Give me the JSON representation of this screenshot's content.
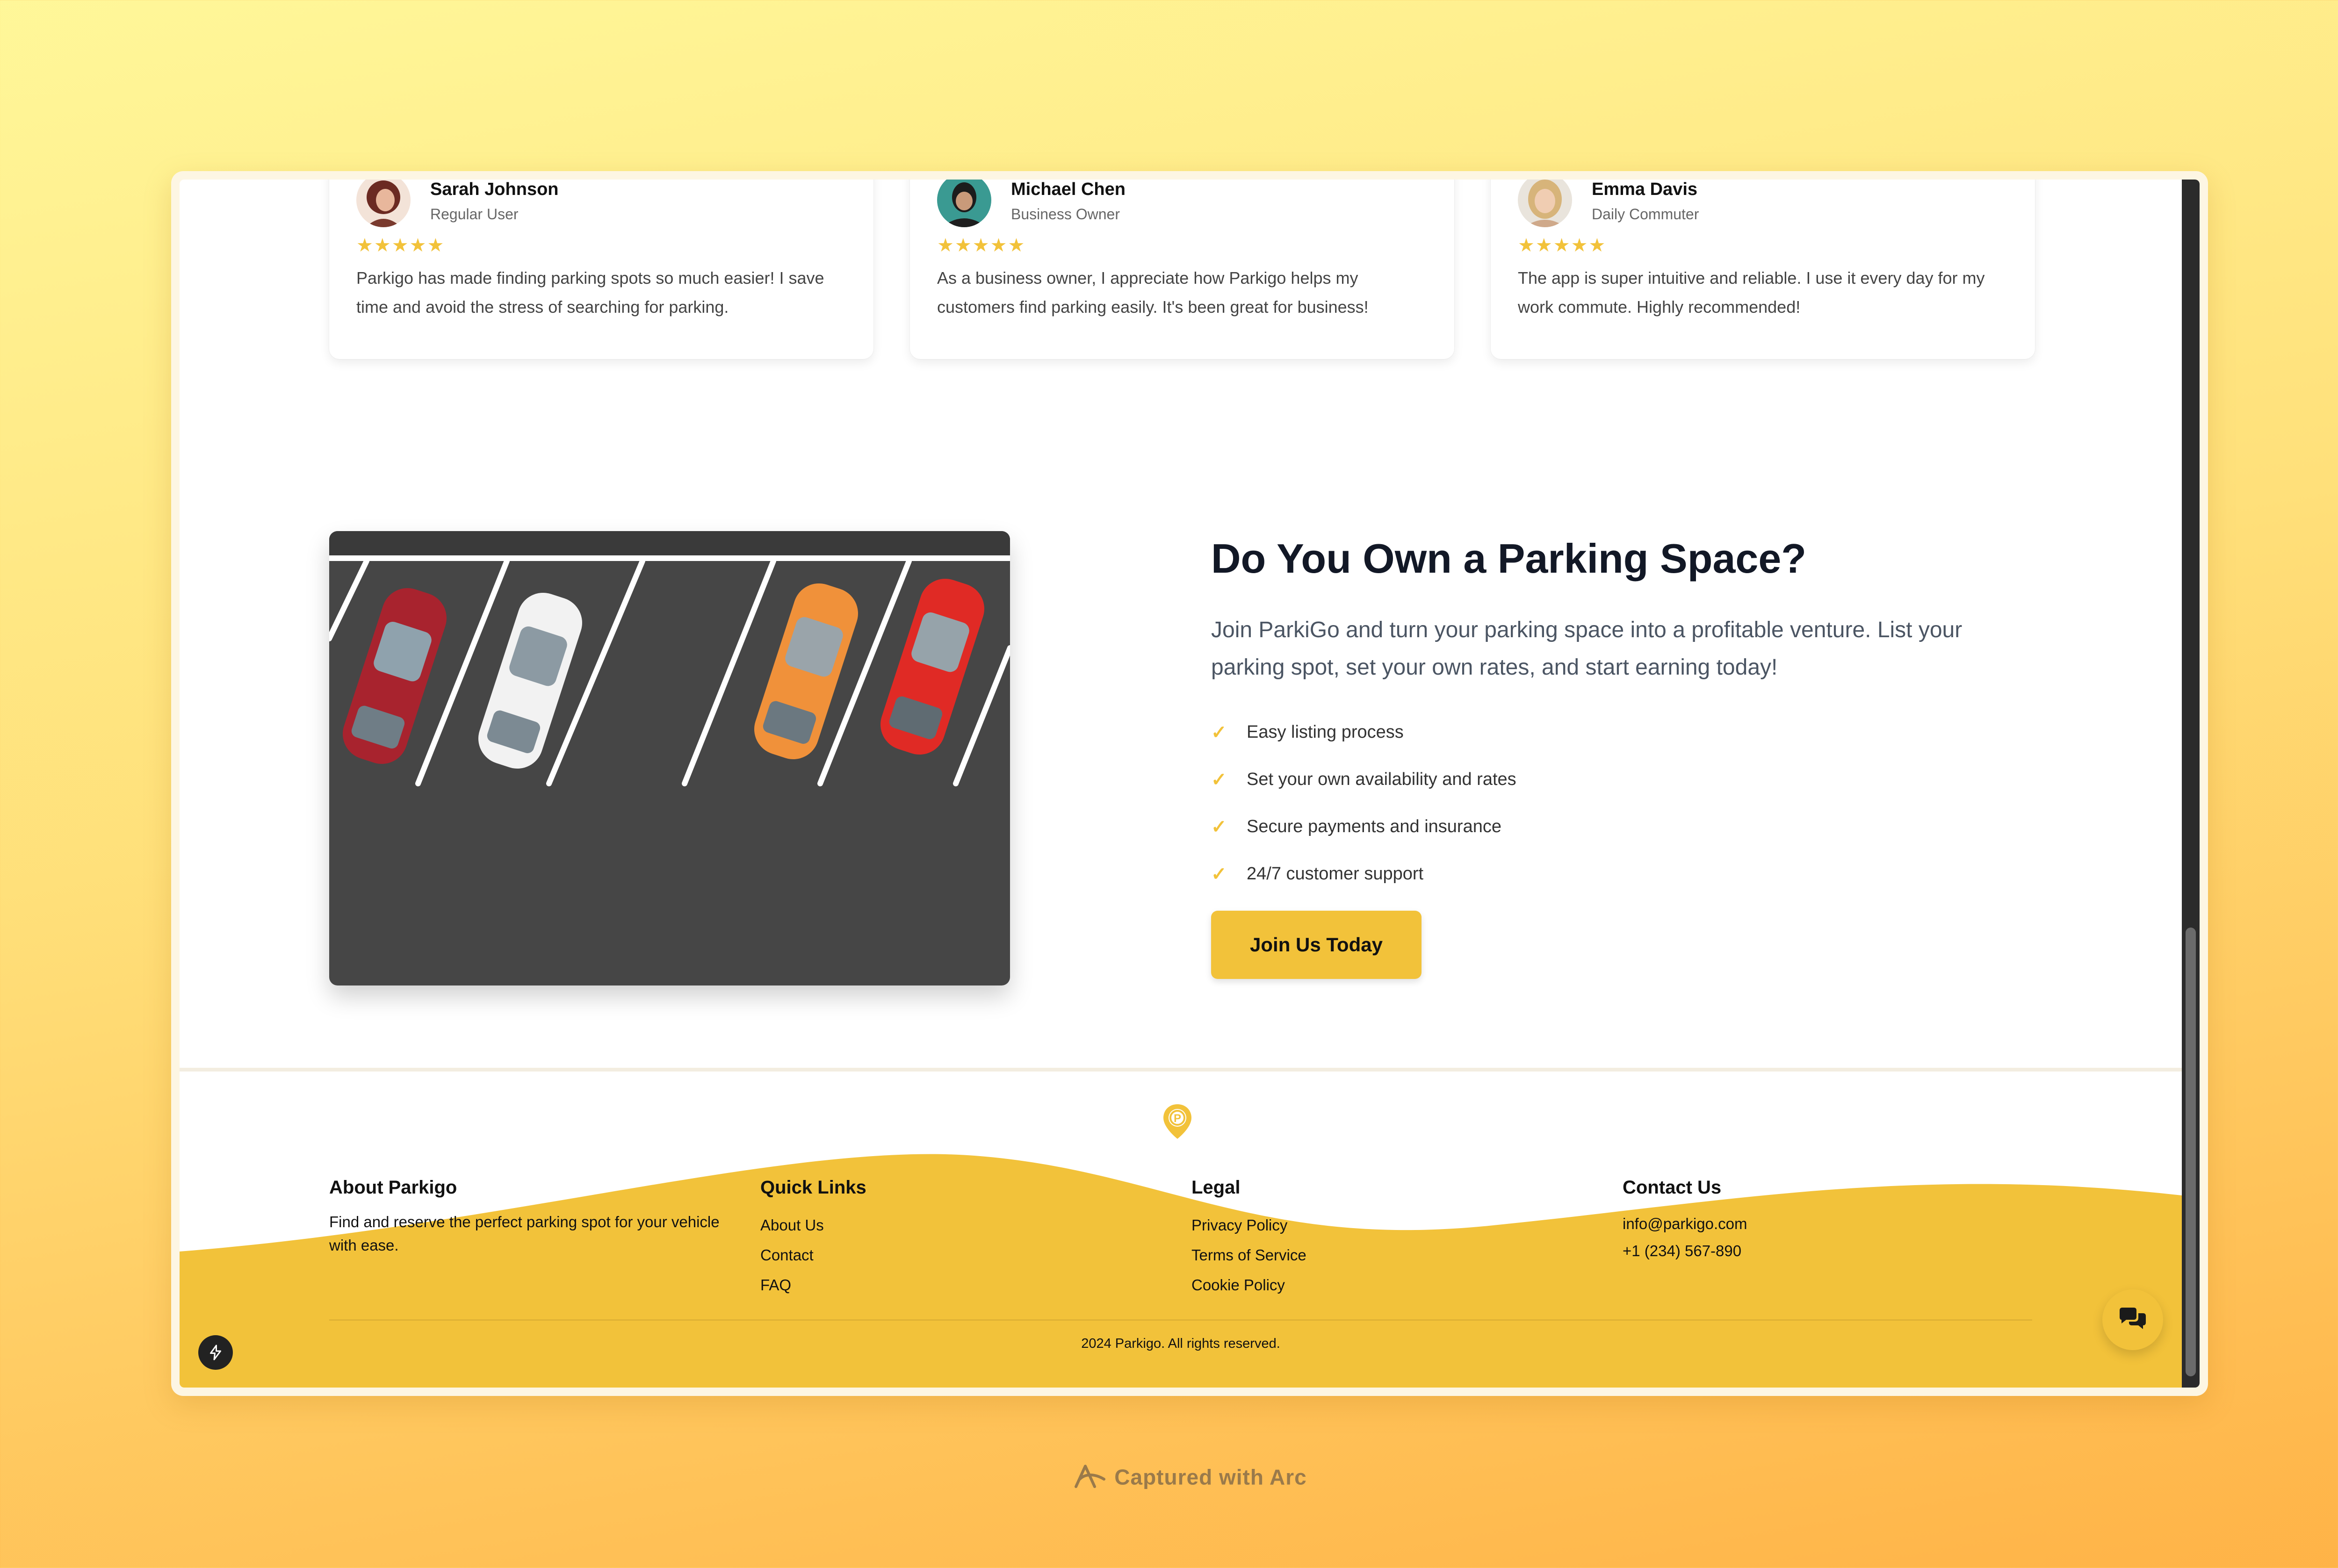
{
  "testimonials": [
    {
      "name": "Sarah Johnson",
      "role": "Regular User",
      "rating": 5,
      "stars": "★★★★★",
      "quote": "Parkigo has made finding parking spots so much easier! I save time and avoid the stress of searching for parking."
    },
    {
      "name": "Michael Chen",
      "role": "Business Owner",
      "rating": 5,
      "stars": "★★★★★",
      "quote": "As a business owner, I appreciate how Parkigo helps my customers find parking easily. It's been great for business!"
    },
    {
      "name": "Emma Davis",
      "role": "Daily Commuter",
      "rating": 5,
      "stars": "★★★★★",
      "quote": "The app is super intuitive and reliable. I use it every day for my work commute. Highly recommended!"
    }
  ],
  "owner": {
    "title": "Do You Own a Parking Space?",
    "description": "Join ParkiGo and turn your parking space into a profitable venture. List your parking spot, set your own rates, and start earning today!",
    "features": [
      "Easy listing process",
      "Set your own availability and rates",
      "Secure payments and insurance",
      "24/7 customer support"
    ],
    "cta_label": "Join Us Today"
  },
  "footer": {
    "about": {
      "heading": "About Parkigo",
      "text": "Find and reserve the perfect parking spot for your vehicle with ease."
    },
    "quick_links": {
      "heading": "Quick Links",
      "items": [
        "About Us",
        "Contact",
        "FAQ"
      ]
    },
    "legal": {
      "heading": "Legal",
      "items": [
        "Privacy Policy",
        "Terms of Service",
        "Cookie Policy"
      ]
    },
    "contact": {
      "heading": "Contact Us",
      "email": "info@parkigo.com",
      "phone": "+1 (234) 567-890"
    },
    "copyright": "2024 Parkigo. All rights reserved."
  },
  "caption": "Captured with Arc",
  "colors": {
    "accent": "#f2c23a",
    "heading": "#121826",
    "body_text": "#4b5563"
  },
  "icons": {
    "check": "check-icon",
    "star": "star-icon",
    "logo": "parking-pin-icon",
    "chat": "chat-bubbles-icon",
    "bolt": "bolt-icon"
  }
}
